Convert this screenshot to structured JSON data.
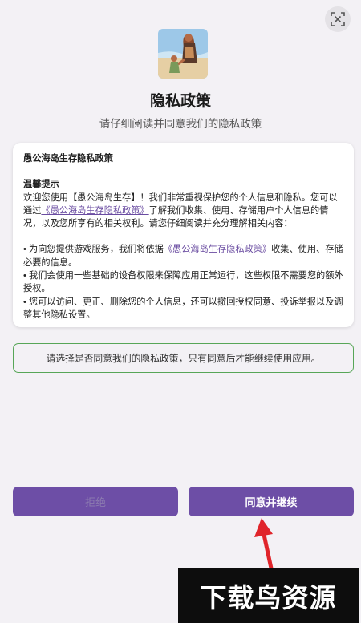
{
  "header": {
    "title": "隐私政策",
    "subtitle": "请仔细阅读并同意我们的隐私政策",
    "scan_icon": "scan-icon",
    "app_icon": "game-character-icon"
  },
  "policy_card": {
    "heading": "愚公海岛生存隐私政策",
    "tips_heading": "温馨提示",
    "intro_part1": "欢迎您使用【愚公海岛生存】！我们非常重视保护您的个人信息和隐私。您可以通过",
    "intro_link": "《愚公海岛生存隐私政策》",
    "intro_part2": "了解我们收集、使用、存储用户个人信息的情况，以及您所享有的相关权利。请您仔细阅读并充分理解相关内容：",
    "bullet1_part1": "• 为向您提供游戏服务，我们将依据",
    "bullet1_link": "《愚公海岛生存隐私政策》",
    "bullet1_part2": "收集、使用、存储必要的信息。",
    "bullet2": "• 我们会使用一些基础的设备权限来保障应用正常运行，这些权限不需要您的额外授权。",
    "bullet3": "• 您可以访问、更正、删除您的个人信息，还可以撤回授权同意、投诉举报以及调整其他隐私设置。"
  },
  "notice": {
    "text": "请选择是否同意我们的隐私政策，只有同意后才能继续使用应用。",
    "border_color": "#57a657"
  },
  "buttons": {
    "decline_label": "拒绝",
    "agree_label": "同意并继续",
    "color": "#6d4ea6"
  },
  "watermark": {
    "text": "下载鸟资源"
  }
}
